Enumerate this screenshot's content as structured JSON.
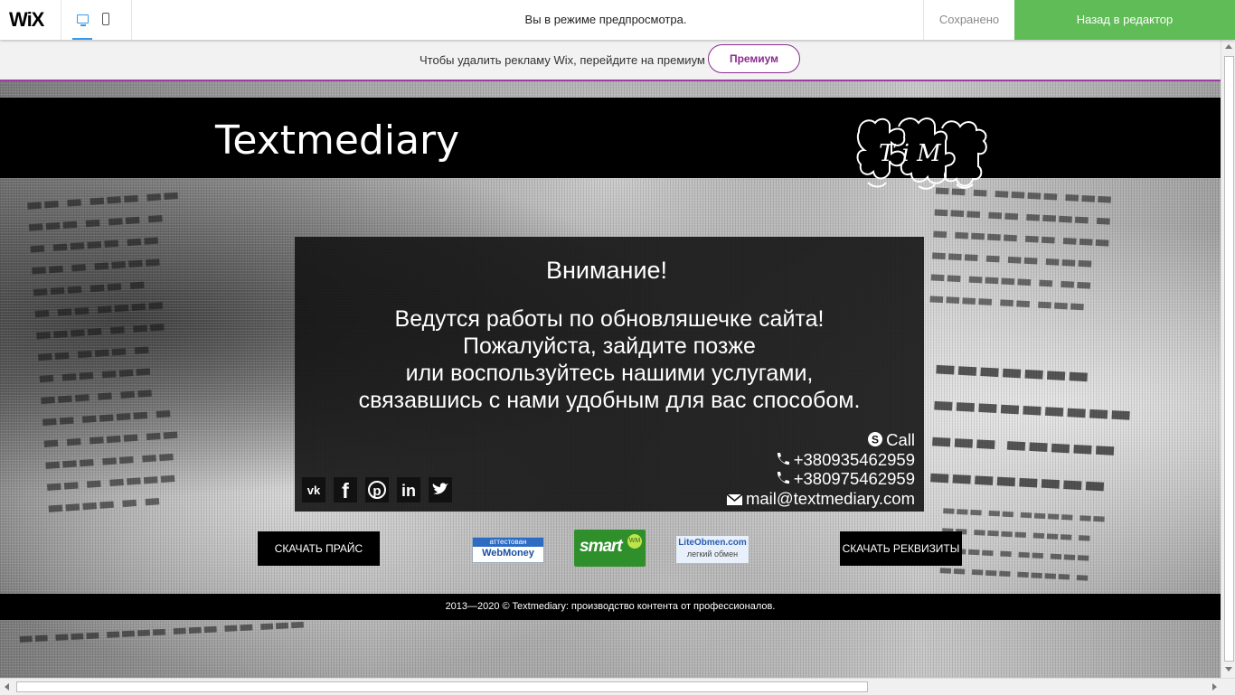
{
  "wix_bar": {
    "logo": "WiX",
    "preview_message": "Вы в режиме предпросмотра.",
    "saved_label": "Сохранено",
    "back_button": "Назад в редактор",
    "icons": [
      "desktop-icon",
      "mobile-icon"
    ]
  },
  "ad_bar": {
    "text": "Чтобы удалить рекламу Wix, перейдите на премиум",
    "premium_button": "Премиум"
  },
  "site": {
    "title": "Textmediary",
    "logo_letters": "T i M",
    "notice": {
      "title": "Внимание!",
      "lines": [
        "Ведутся работы по обновляшечке сайта!",
        "Пожалуйста, зайдите позже",
        "или воспользуйтесь нашими услугами,",
        "связавшись с нами удобным для вас способом."
      ]
    },
    "contacts": {
      "skype": "Call",
      "phone1": "+380935462959",
      "phone2": "+380975462959",
      "email": "mail@textmediary.com"
    },
    "socials": [
      "vk-icon",
      "facebook-icon",
      "pinterest-icon",
      "linkedin-icon",
      "twitter-icon"
    ],
    "download_price": "СКАЧАТЬ ПРАЙС",
    "download_requisites": "СКАЧАТЬ РЕКВИЗИТЫ",
    "badges": {
      "webmoney_top": "аттестован",
      "webmoney_bottom": "WebMoney",
      "smart": "smart",
      "smart_wm": "WM",
      "liteobmen_top": "LiteObmen.com",
      "liteobmen_bottom": "легкий обмен"
    },
    "footer": "2013—2020 © Textmediary: производство контента от профессионалов."
  },
  "colors": {
    "wix_green": "#60bc57",
    "premium_purple": "#8b2c8e",
    "wix_blue": "#3899ec"
  }
}
